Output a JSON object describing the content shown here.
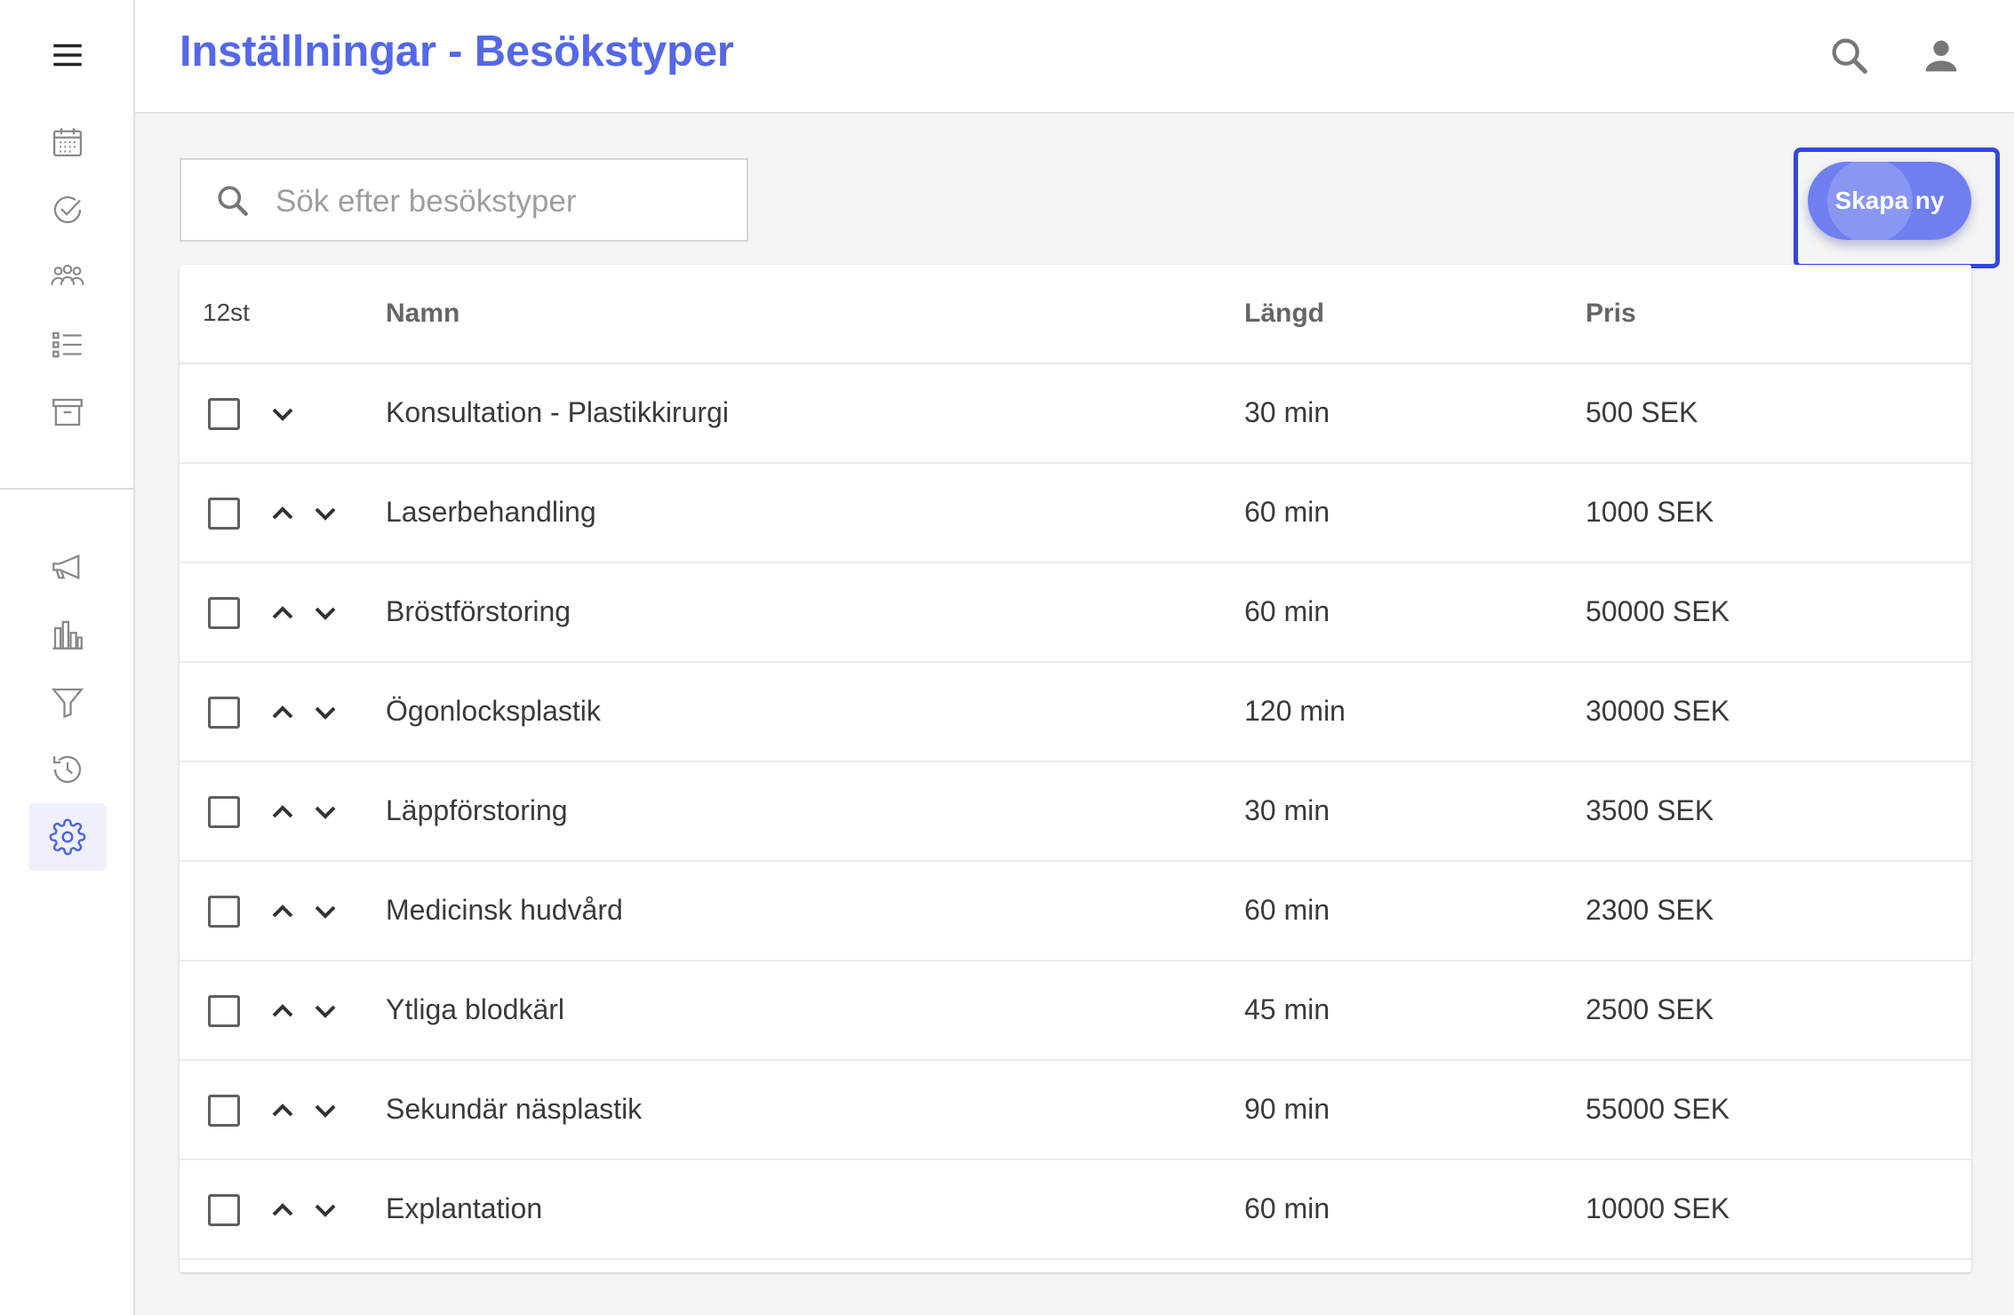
{
  "header": {
    "title": "Inställningar - Besökstyper"
  },
  "search": {
    "placeholder": "Sök efter besökstyper",
    "value": ""
  },
  "actions": {
    "create_label": "Skapa ny"
  },
  "accent_color": "#5468e8",
  "sidebar": {
    "menu_icon": "hamburger-menu-icon",
    "items": [
      {
        "icon": "calendar-icon",
        "active": false
      },
      {
        "icon": "check-circle-icon",
        "active": false
      },
      {
        "icon": "people-group-icon",
        "active": false
      },
      {
        "icon": "list-icon",
        "active": false
      },
      {
        "icon": "archive-box-icon",
        "active": false
      },
      {
        "icon": "megaphone-icon",
        "active": false
      },
      {
        "icon": "bar-chart-icon",
        "active": false
      },
      {
        "icon": "funnel-icon",
        "active": false
      },
      {
        "icon": "history-icon",
        "active": false
      },
      {
        "icon": "gear-icon",
        "active": true
      }
    ]
  },
  "table": {
    "count": "12st",
    "columns": {
      "name": "Namn",
      "length": "Längd",
      "price": "Pris"
    },
    "rows": [
      {
        "name": "Konsultation - Plastikkirurgi",
        "length": "30 min",
        "price": "500 SEK"
      },
      {
        "name": "Laserbehandling",
        "length": "60 min",
        "price": "1000 SEK"
      },
      {
        "name": "Bröstförstoring",
        "length": "60 min",
        "price": "50000 SEK"
      },
      {
        "name": "Ögonlocksplastik",
        "length": "120 min",
        "price": "30000 SEK"
      },
      {
        "name": "Läppförstoring",
        "length": "30 min",
        "price": "3500 SEK"
      },
      {
        "name": "Medicinsk hudvård",
        "length": "60 min",
        "price": "2300 SEK"
      },
      {
        "name": "Ytliga blodkärl",
        "length": "45 min",
        "price": "2500 SEK"
      },
      {
        "name": "Sekundär näsplastik",
        "length": "90 min",
        "price": "55000 SEK"
      },
      {
        "name": "Explantation",
        "length": "60 min",
        "price": "10000 SEK"
      }
    ]
  }
}
